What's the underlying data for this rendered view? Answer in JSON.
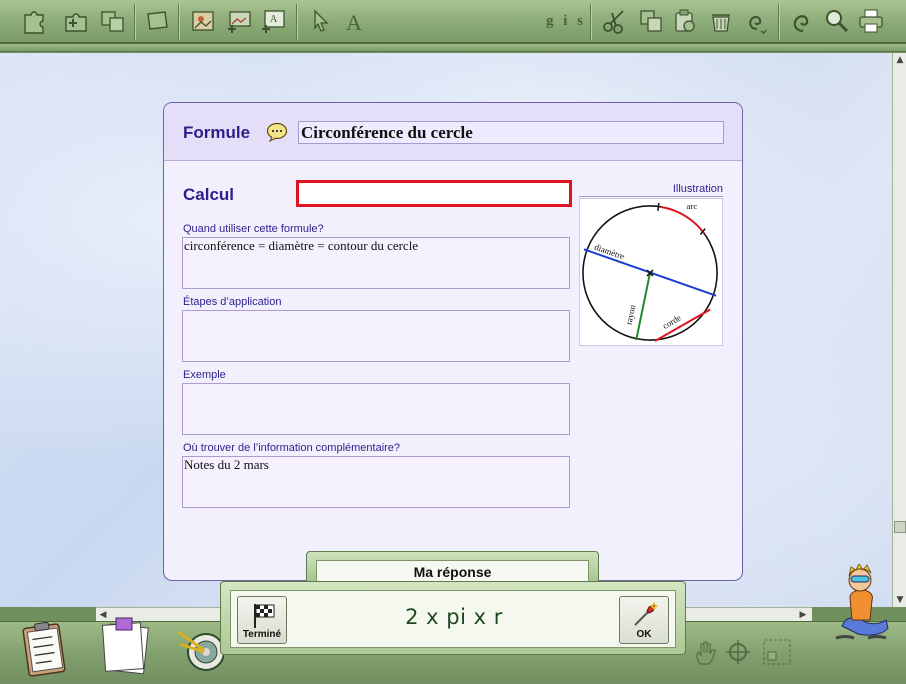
{
  "card": {
    "formule_label": "Formule",
    "title": "Circonférence du cercle",
    "calcul_label": "Calcul",
    "calcul_value": "",
    "illustration_label": "Illustration",
    "fields": [
      {
        "label": "Quand utiliser cette formule?",
        "value": "circonférence = diamètre = contour du cercle"
      },
      {
        "label": "Étapes d’application",
        "value": ""
      },
      {
        "label": "Exemple",
        "value": ""
      },
      {
        "label": "Où trouver de l’information complémentaire?",
        "value": "Notes du 2 mars"
      }
    ],
    "illustration": {
      "arc": "arc",
      "diametre": "diamètre",
      "rayon": "rayon",
      "corde": "corde"
    }
  },
  "answer": {
    "title": "Ma réponse",
    "value": "2 x pi x r",
    "done_label": "Terminé",
    "ok_label": "OK"
  },
  "toolbar": {
    "text_styles": "g i s",
    "icons": [
      "puzzle-pieces-icon",
      "add-puzzle-icon",
      "puzzle-group-icon",
      "sheet-icon",
      "image-card-icon",
      "add-image-icon",
      "add-text-icon",
      "pointer-icon",
      "text-tool-icon",
      "text-style-icon",
      "scissors-icon",
      "copy-icon",
      "paste-icon",
      "trash-icon",
      "swirl-icon",
      "spiral-icon",
      "magnifier-icon",
      "printer-icon"
    ]
  },
  "colors": {
    "accent_purple": "#2d1f8a",
    "calcul_border": "#e01420",
    "toolbar_green": "#88a874",
    "answer_text": "#1d4a1d"
  }
}
